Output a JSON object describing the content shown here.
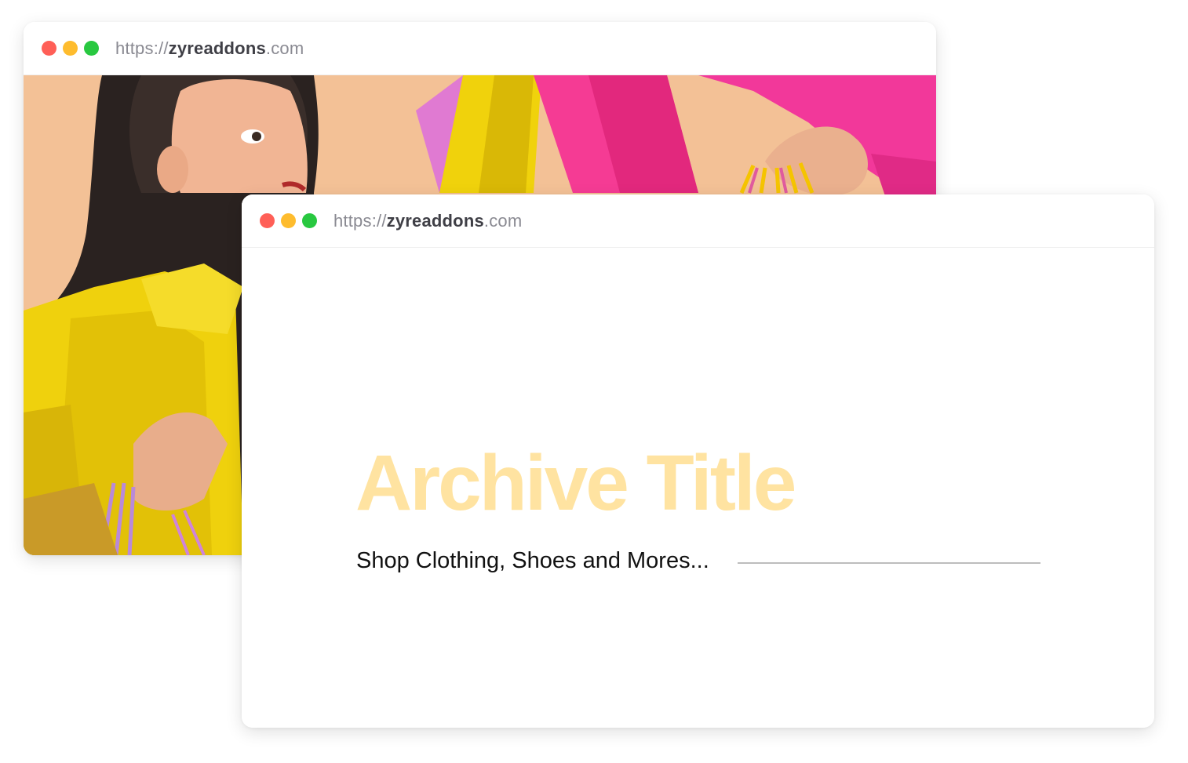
{
  "colors": {
    "dot_close": "#ff5f57",
    "dot_minimize": "#febc2e",
    "dot_maximize": "#28c840",
    "title_color": "#ffe3a1",
    "hero_background": "#f4c094"
  },
  "back_window": {
    "url": {
      "scheme": "https://",
      "domain": "zyreaddons",
      "tld": ".com"
    },
    "hero_image": "hero-image-woman-with-shopping-bags"
  },
  "front_window": {
    "url": {
      "scheme": "https://",
      "domain": "zyreaddons",
      "tld": ".com"
    },
    "title": "Archive Title",
    "subtitle": "Shop Clothing, Shoes and Mores..."
  }
}
